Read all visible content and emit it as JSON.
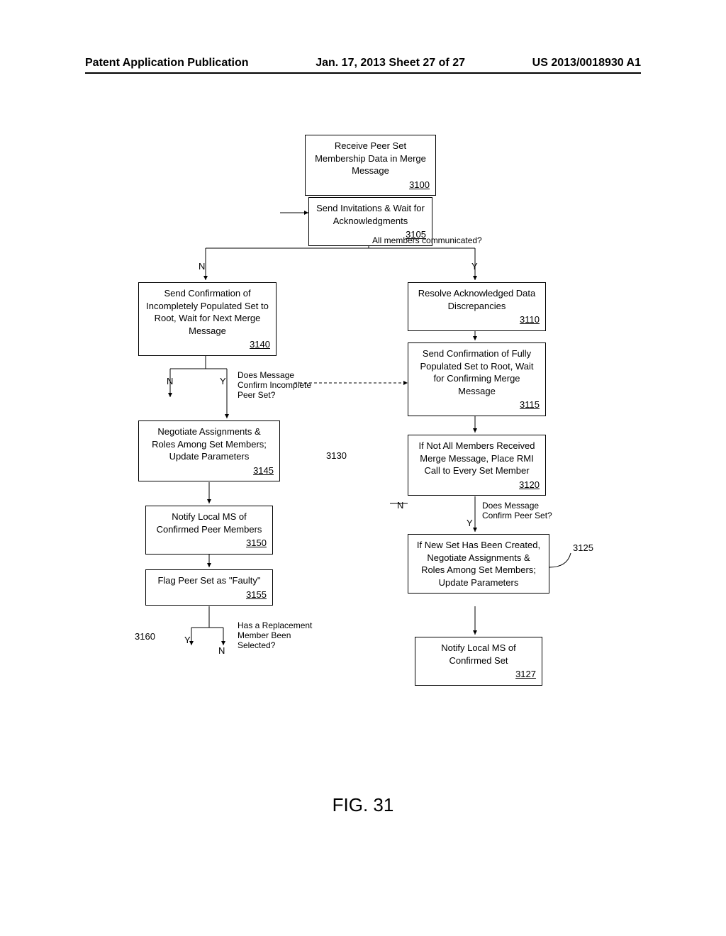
{
  "header": {
    "left": "Patent Application Publication",
    "center": "Jan. 17, 2013  Sheet 27 of 27",
    "right": "US 2013/0018930 A1"
  },
  "boxes": {
    "b3100": {
      "text": "Receive Peer Set Membership Data in Merge Message",
      "ref": "3100"
    },
    "b3105": {
      "text": "Send Invitations & Wait for Acknowledgments",
      "ref": "3105"
    },
    "b3110": {
      "text": "Resolve Acknowledged Data Discrepancies",
      "ref": "3110"
    },
    "b3115": {
      "text": "Send Confirmation of Fully Populated Set to Root, Wait for Confirming Merge Message",
      "ref": "3115"
    },
    "b3120": {
      "text": "If Not All Members Received Merge Message, Place RMI Call to Every Set Member",
      "ref": "3120"
    },
    "b3125": {
      "text": "If New Set Has Been Created, Negotiate Assignments & Roles Among Set Members; Update Parameters"
    },
    "b3127": {
      "text": "Notify Local MS of Confirmed Set",
      "ref": "3127"
    },
    "b3140": {
      "text": "Send Confirmation of Incompletely Populated Set to Root, Wait for Next Merge Message",
      "ref": "3140"
    },
    "b3145": {
      "text": "Negotiate Assignments & Roles Among Set Members; Update Parameters",
      "ref": "3145"
    },
    "b3150": {
      "text": "Notify Local MS of Confirmed Peer Members",
      "ref": "3150"
    },
    "b3155": {
      "text": "Flag Peer Set as \"Faulty\"",
      "ref": "3155"
    }
  },
  "labels": {
    "all_members": "All members communicated?",
    "confirm_incomplete": "Does Message Confirm Incomplete Peer Set?",
    "confirm_peer": "Does Message Confirm Peer Set?",
    "replacement": "Has a Replacement Member Been Selected?",
    "y": "Y",
    "n": "N",
    "c3125": "3125",
    "c3130": "3130",
    "c3160": "3160"
  },
  "figure": "FIG. 31"
}
